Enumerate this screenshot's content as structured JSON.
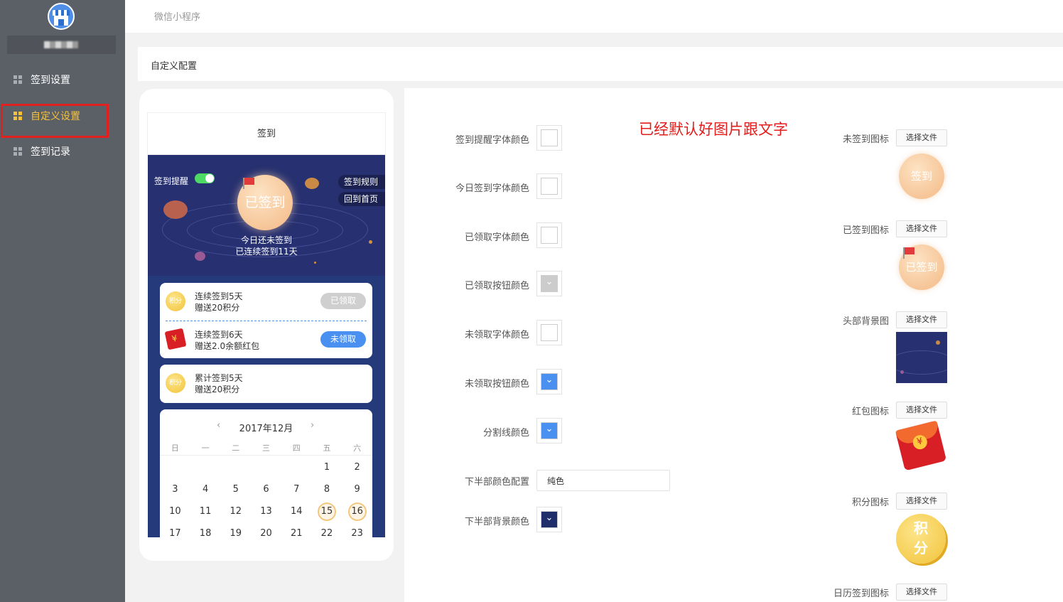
{
  "sidebar": {
    "items": [
      {
        "label": "签到设置"
      },
      {
        "label": "自定义设置"
      },
      {
        "label": "签到记录"
      }
    ]
  },
  "topbar": {
    "breadcrumb": "微信小程序"
  },
  "section": {
    "title": "自定义配置"
  },
  "phone": {
    "title": "签到",
    "remind_label": "签到提醒",
    "rules_label": "签到规则",
    "home_label": "回到首页",
    "signed_button": "已签到",
    "status_line1": "今日还未签到",
    "status_line2": "已连续签到11天",
    "rewards": [
      {
        "coin": "积分",
        "line1": "连续签到5天",
        "line2": "赠送20积分",
        "button": "已领取"
      },
      {
        "line1": "连续签到6天",
        "line2": "赠送2.0余额红包",
        "button": "未领取"
      }
    ],
    "cumulative": {
      "coin": "积分",
      "line1": "累计签到5天",
      "line2": "赠送20积分"
    },
    "calendar": {
      "month": "2017年12月",
      "prev": "‹",
      "next": "›",
      "weekdays": [
        "日",
        "一",
        "二",
        "三",
        "四",
        "五",
        "六"
      ],
      "rows": [
        [
          "",
          "",
          "",
          "",
          "",
          "1",
          "2"
        ],
        [
          "3",
          "4",
          "5",
          "6",
          "7",
          "8",
          "9"
        ],
        [
          "10",
          "11",
          "12",
          "13",
          "14",
          "15",
          "16"
        ],
        [
          "17",
          "18",
          "19",
          "20",
          "21",
          "22",
          "23"
        ]
      ],
      "signed_days": [
        "15",
        "16"
      ]
    }
  },
  "config": {
    "note": "已经默认好图片跟文字",
    "colors": [
      {
        "label": "签到提醒字体颜色",
        "color": "#ffffff"
      },
      {
        "label": "今日签到字体颜色",
        "color": "#ffffff"
      },
      {
        "label": "已领取字体颜色",
        "color": "#ffffff"
      },
      {
        "label": "已领取按钮颜色",
        "color": "#cccccc"
      },
      {
        "label": "未领取字体颜色",
        "color": "#ffffff"
      },
      {
        "label": "未领取按钮颜色",
        "color": "#4a90f0"
      },
      {
        "label": "分割线颜色",
        "color": "#4a90f0"
      }
    ],
    "bottom_color_config": {
      "label": "下半部颜色配置",
      "value": "纯色"
    },
    "bottom_bg_color": {
      "label": "下半部背景颜色",
      "color": "#1f2d6b"
    },
    "images": [
      {
        "label": "未签到图标",
        "button": "选择文件",
        "preview_text": "签到"
      },
      {
        "label": "已签到图标",
        "button": "选择文件",
        "preview_text": "已签到"
      },
      {
        "label": "头部背景图",
        "button": "选择文件"
      },
      {
        "label": "红包图标",
        "button": "选择文件"
      },
      {
        "label": "积分图标",
        "button": "选择文件",
        "preview_text1": "积",
        "preview_text2": "分"
      },
      {
        "label": "日历签到图标",
        "button": "选择文件"
      }
    ]
  }
}
